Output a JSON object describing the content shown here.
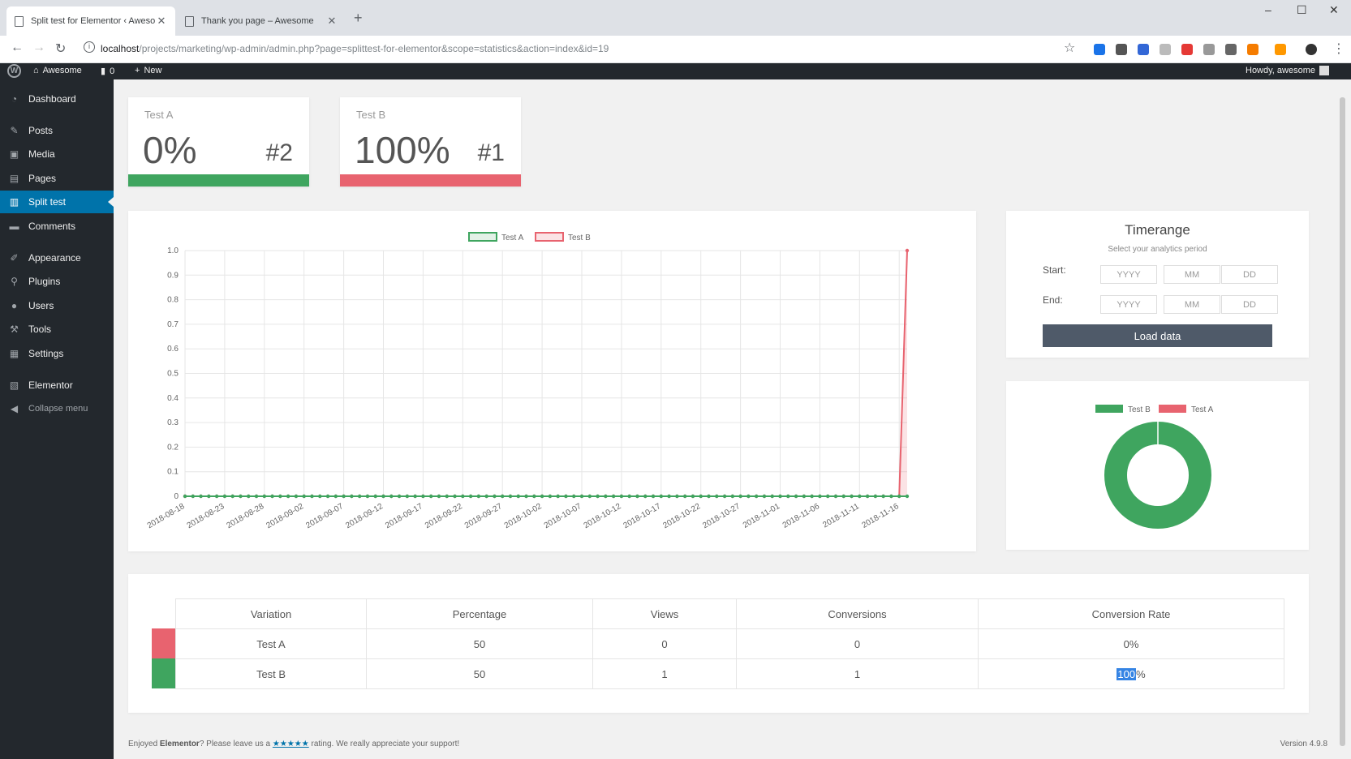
{
  "browser": {
    "tabs": [
      {
        "title": "Split test for Elementor ‹ Aweso"
      },
      {
        "title": "Thank you page – Awesome"
      }
    ],
    "new_tab": "+",
    "close": "✕",
    "url_host": "localhost",
    "url_path": "/projects/marketing/wp-admin/admin.php?page=splittest-for-elementor&scope=statistics&action=index&id=19",
    "window_controls": [
      "–",
      "☐",
      "✕"
    ]
  },
  "adminbar": {
    "site_name": "Awesome",
    "comments_count": "0",
    "new_label": "New",
    "howdy": "Howdy, awesome"
  },
  "sidebar": {
    "items": [
      {
        "label": "Dashboard",
        "icon": "dashboard-icon"
      },
      {
        "label": "Posts",
        "icon": "pin-icon"
      },
      {
        "label": "Media",
        "icon": "media-icon"
      },
      {
        "label": "Pages",
        "icon": "pages-icon"
      },
      {
        "label": "Split test",
        "icon": "split-test-icon"
      },
      {
        "label": "Comments",
        "icon": "comments-icon"
      },
      {
        "label": "Appearance",
        "icon": "brush-icon"
      },
      {
        "label": "Plugins",
        "icon": "plugin-icon"
      },
      {
        "label": "Users",
        "icon": "users-icon"
      },
      {
        "label": "Tools",
        "icon": "wrench-icon"
      },
      {
        "label": "Settings",
        "icon": "settings-icon"
      },
      {
        "label": "Elementor",
        "icon": "elementor-icon"
      },
      {
        "label": "Collapse menu",
        "icon": "collapse-icon"
      }
    ]
  },
  "stats": {
    "test_a": {
      "label": "Test A",
      "percent": "0%",
      "rank": "#2",
      "color": "#3fa55f"
    },
    "test_b": {
      "label": "Test B",
      "percent": "100%",
      "rank": "#1",
      "color": "#e8636f"
    }
  },
  "timerange": {
    "title": "Timerange",
    "subtitle": "Select your analytics period",
    "start_label": "Start:",
    "end_label": "End:",
    "placeholders": {
      "year": "YYYY",
      "month": "MM",
      "day": "DD"
    },
    "load_button": "Load data"
  },
  "chart_data": [
    {
      "type": "line",
      "legend": [
        "Test A",
        "Test B"
      ],
      "ylim": [
        0,
        1
      ],
      "yticks": [
        "0",
        "0.1",
        "0.2",
        "0.3",
        "0.4",
        "0.5",
        "0.6",
        "0.7",
        "0.8",
        "0.9",
        "1.0"
      ],
      "xticks": [
        "2018-08-18",
        "2018-08-23",
        "2018-08-28",
        "2018-09-02",
        "2018-09-07",
        "2018-09-12",
        "2018-09-17",
        "2018-09-22",
        "2018-09-27",
        "2018-10-02",
        "2018-10-07",
        "2018-10-12",
        "2018-10-17",
        "2018-10-22",
        "2018-10-27",
        "2018-11-01",
        "2018-11-06",
        "2018-11-11",
        "2018-11-16"
      ],
      "x_range": [
        "2018-08-18",
        "2018-11-17"
      ],
      "series": [
        {
          "name": "Test A",
          "color": "#3fa55f",
          "values": "0 on every day from 2018-08-18 to 2018-11-17"
        },
        {
          "name": "Test B",
          "color": "#e8636f",
          "values": "0 on every day from 2018-08-18 to 2018-11-16, 1 on 2018-11-17"
        }
      ],
      "grid": true,
      "legend_position": "top"
    },
    {
      "type": "pie",
      "legend": [
        "Test B",
        "Test A"
      ],
      "slices": [
        {
          "label": "Test B",
          "value": 1,
          "color": "#3fa55f"
        },
        {
          "label": "Test A",
          "value": 0,
          "color": "#e8636f"
        }
      ],
      "legend_position": "top"
    }
  ],
  "table": {
    "headers": [
      "Variation",
      "Percentage",
      "Views",
      "Conversions",
      "Conversion Rate"
    ],
    "rows": [
      {
        "variation": "Test A",
        "percentage": "50",
        "views": "0",
        "conversions": "0",
        "rate": "0%",
        "color": "#e8636f"
      },
      {
        "variation": "Test B",
        "percentage": "50",
        "views": "1",
        "conversions": "1",
        "rate_selected": "100",
        "rate_suffix": "%",
        "color": "#3fa55f"
      }
    ]
  },
  "footer": {
    "text_pre": "Enjoyed ",
    "brand": "Elementor",
    "text_mid": "? Please leave us a ",
    "stars": "★★★★★",
    "text_post": " rating. We really appreciate your support!",
    "version": "Version 4.9.8"
  }
}
